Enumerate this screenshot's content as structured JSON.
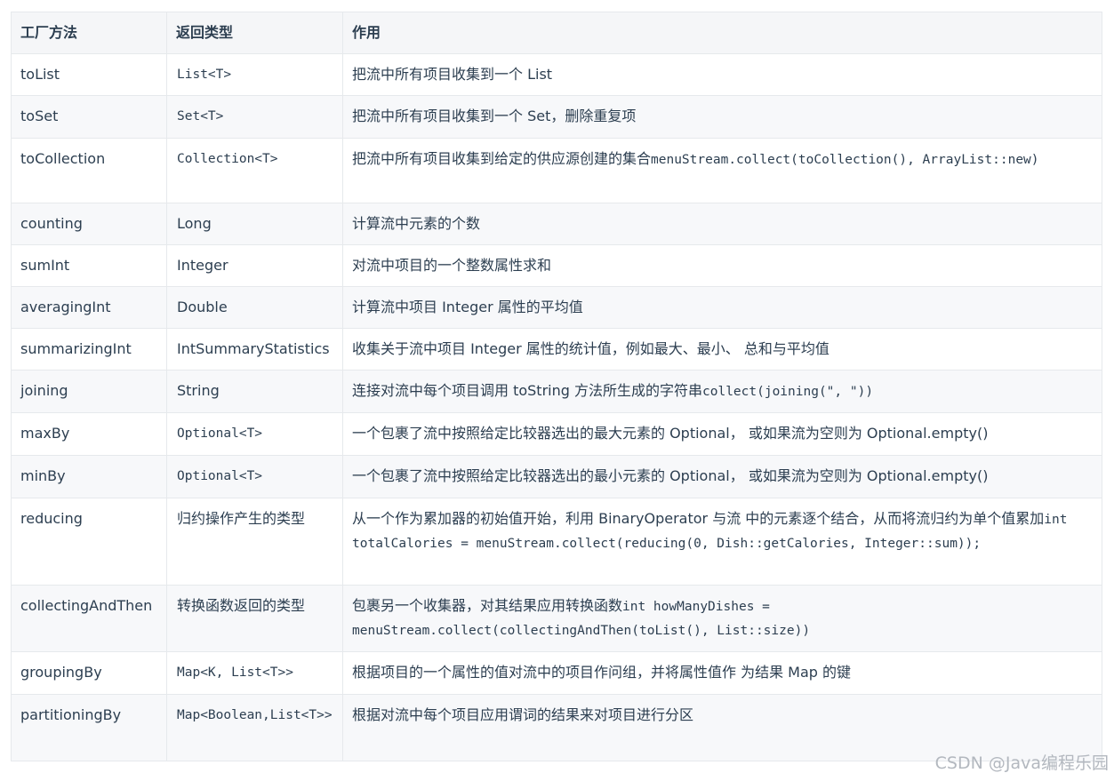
{
  "table": {
    "headers": [
      "工厂方法",
      "返回类型",
      "作用"
    ],
    "rows": [
      {
        "method": "toList",
        "return_type": "List<T>",
        "return_mono": true,
        "desc_text": "把流中所有项目收集到一个 List",
        "desc_code": ""
      },
      {
        "method": "toSet",
        "return_type": "Set<T>",
        "return_mono": true,
        "desc_text": "把流中所有项目收集到一个 Set，删除重复项",
        "desc_code": ""
      },
      {
        "method": "toCollection",
        "return_type": "Collection<T>",
        "return_mono": true,
        "desc_text": "把流中所有项目收集到给定的供应源创建的集合",
        "desc_code": "menuStream.collect(toCollection(), ArrayList::new)"
      },
      {
        "method": "counting",
        "return_type": "Long",
        "return_mono": false,
        "desc_text": "计算流中元素的个数",
        "desc_code": ""
      },
      {
        "method": "sumInt",
        "return_type": "Integer",
        "return_mono": false,
        "desc_text": "对流中项目的一个整数属性求和",
        "desc_code": ""
      },
      {
        "method": "averagingInt",
        "return_type": "Double",
        "return_mono": false,
        "desc_text": "计算流中项目 Integer 属性的平均值",
        "desc_code": ""
      },
      {
        "method": "summarizingInt",
        "return_type": "IntSummaryStatistics",
        "return_mono": false,
        "desc_text": "收集关于流中项目 Integer 属性的统计值，例如最大、最小、 总和与平均值",
        "desc_code": ""
      },
      {
        "method": "joining",
        "return_type": "String",
        "return_mono": false,
        "desc_text": "连接对流中每个项目调用 toString 方法所生成的字符串",
        "desc_code": "collect(joining(\", \"))"
      },
      {
        "method": "maxBy",
        "return_type": "Optional<T>",
        "return_mono": true,
        "desc_text": "一个包裹了流中按照给定比较器选出的最大元素的 Optional， 或如果流为空则为 Optional.empty()",
        "desc_code": ""
      },
      {
        "method": "minBy",
        "return_type": "Optional<T>",
        "return_mono": true,
        "desc_text": "一个包裹了流中按照给定比较器选出的最小元素的 Optional， 或如果流为空则为 Optional.empty()",
        "desc_code": ""
      },
      {
        "method": "reducing",
        "return_type": "归约操作产生的类型",
        "return_mono": false,
        "desc_text": "从一个作为累加器的初始值开始，利用 BinaryOperator 与流 中的元素逐个结合，从而将流归约为单个值累加",
        "desc_code": "int totalCalories = menuStream.collect(reducing(0, Dish::getCalories, Integer::sum));"
      },
      {
        "method": "collectingAndThen",
        "return_type": "转换函数返回的类型",
        "return_mono": false,
        "desc_text": "包裹另一个收集器，对其结果应用转换函数",
        "desc_code": "int howManyDishes = menuStream.collect(collectingAndThen(toList(), List::size))"
      },
      {
        "method": "groupingBy",
        "return_type": "Map<K, List<T>>",
        "return_mono": true,
        "desc_text": "根据项目的一个属性的值对流中的项目作问组，并将属性值作 为结果 Map 的键",
        "desc_code": ""
      },
      {
        "method": "partitioningBy",
        "return_type": "Map<Boolean,List<T>>",
        "return_mono": true,
        "desc_text": "根据对流中每个项目应用谓词的结果来对项目进行分区",
        "desc_code": ""
      }
    ]
  },
  "watermark": "CSDN @Java编程乐园"
}
